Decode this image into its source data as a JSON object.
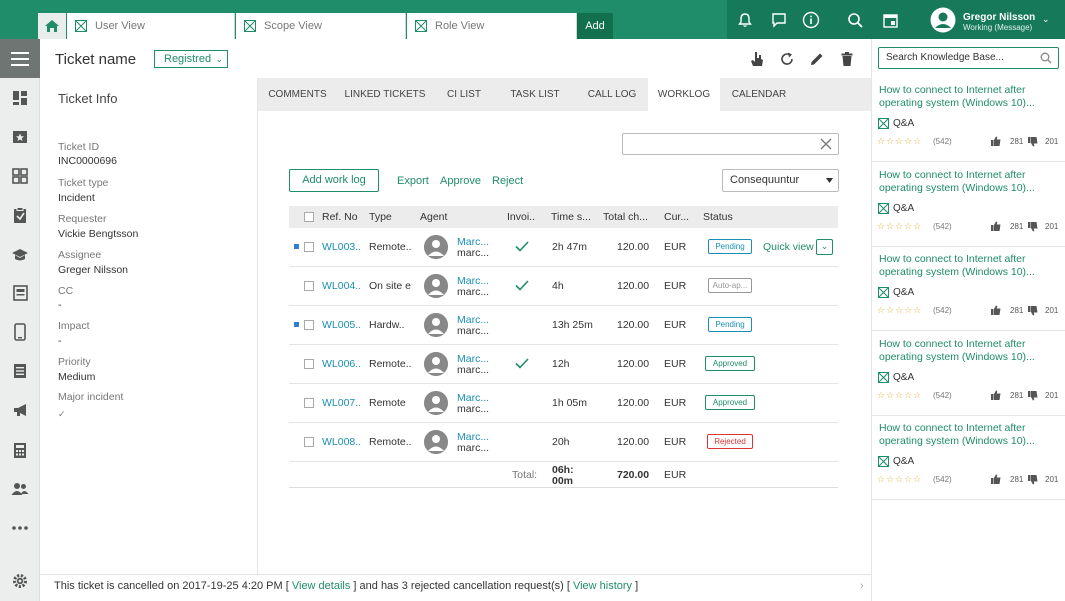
{
  "colors": {
    "brand": "#1f8c6a",
    "brand_dark": "#167a5a",
    "link": "#1a8fb3",
    "rejected": "#d33333",
    "pending_dot": "#2f7fd8"
  },
  "tabs": [
    {
      "label": "User View",
      "icon": "grid-x-icon"
    },
    {
      "label": "Scope View",
      "icon": "grid-x-icon"
    },
    {
      "label": "Role View",
      "icon": "grid-x-icon"
    }
  ],
  "add_tab": "Add",
  "user": {
    "name": "Gregor Nilsson",
    "status": "Working (Message)"
  },
  "header": {
    "ticket_name": "Ticket name",
    "status": "Registred"
  },
  "info": {
    "title": "Ticket Info",
    "fields": [
      {
        "label": "Ticket ID",
        "value": "INC0000696"
      },
      {
        "label": "Ticket type",
        "value": "Incident"
      },
      {
        "label": "Requester",
        "value": "Vickie Bengtsson"
      },
      {
        "label": "Assignee",
        "value": "Greger Nilsson"
      },
      {
        "label": "CC",
        "value": "-"
      },
      {
        "label": "Impact",
        "value": "-"
      },
      {
        "label": "Priority",
        "value": "Medium"
      },
      {
        "label": "Major incident",
        "value": "✓"
      }
    ]
  },
  "panel_tabs": [
    "COMMENTS",
    "LINKED TICKETS",
    "CI LIST",
    "TASK LIST",
    "CALL LOG",
    "WORKLOG",
    "CALENDAR"
  ],
  "worklog": {
    "add_label": "Add work log",
    "export_label": "Export",
    "approve_label": "Approve",
    "reject_label": "Reject",
    "filter_value": "Consequuntur",
    "search_value": "",
    "columns": [
      "Ref. No",
      "Type",
      "Agent",
      "Invoi..",
      "Time s...",
      "Total ch...",
      "Cur...",
      "Status"
    ],
    "rows": [
      {
        "ref": "WL003..",
        "type": "Remote..",
        "agent_name": "Marc...",
        "agent_sub": "marc...",
        "invoiced": true,
        "time": "2h 47m",
        "total": "120.00",
        "currency": "EUR",
        "status": "Pending",
        "status_kind": "pending",
        "unread": true
      },
      {
        "ref": "WL004..",
        "type": "On site e...",
        "agent_name": "Marc...",
        "agent_sub": "marc...",
        "invoiced": true,
        "time": "4h",
        "total": "120.00",
        "currency": "EUR",
        "status": "Auto-ap...",
        "status_kind": "auto",
        "unread": false
      },
      {
        "ref": "WL005..",
        "type": "Hardw..",
        "agent_name": "Marc...",
        "agent_sub": "marc...",
        "invoiced": false,
        "time": "13h 25m",
        "total": "120.00",
        "currency": "EUR",
        "status": "Pending",
        "status_kind": "pending",
        "unread": true
      },
      {
        "ref": "WL006..",
        "type": "Remote..",
        "agent_name": "Marc...",
        "agent_sub": "marc...",
        "invoiced": true,
        "time": "12h",
        "total": "120.00",
        "currency": "EUR",
        "status": "Approved",
        "status_kind": "approved",
        "unread": false
      },
      {
        "ref": "WL007..",
        "type": "Remote",
        "agent_name": "Marc...",
        "agent_sub": "marc...",
        "invoiced": false,
        "time": "1h 05m",
        "total": "120.00",
        "currency": "EUR",
        "status": "Approved",
        "status_kind": "approved",
        "unread": false
      },
      {
        "ref": "WL008..",
        "type": "Remote..",
        "agent_name": "Marc...",
        "agent_sub": "marc...",
        "invoiced": false,
        "time": "20h",
        "total": "120.00",
        "currency": "EUR",
        "status": "Rejected",
        "status_kind": "rejected",
        "unread": false
      }
    ],
    "quick_view": "Quick view",
    "totals": {
      "label": "Total:",
      "time_line1": "06h:",
      "time_line2": "00m",
      "amount": "720.00",
      "currency": "EUR"
    }
  },
  "footer": {
    "text1": "This ticket is cancelled on 2017-19-25 4:20 PM [",
    "link1": "View details",
    "text2": "] and has 3 rejected cancellation request(s)  [",
    "link2": "View history",
    "text3": "]"
  },
  "kb": {
    "search_placeholder": "Search Knowledge Base...",
    "items": [
      {
        "title": "How to connect to Internet after operating system (Windows 10)...",
        "type": "Q&A",
        "stars": "☆☆☆☆☆",
        "count": "(542)",
        "up": "281",
        "down": "201"
      },
      {
        "title": "How to connect to Internet after operating system (Windows 10)...",
        "type": "Q&A",
        "stars": "☆☆☆☆☆",
        "count": "(542)",
        "up": "281",
        "down": "201"
      },
      {
        "title": "How to connect to Internet after operating system (Windows 10)...",
        "type": "Q&A",
        "stars": "☆☆☆☆☆",
        "count": "(542)",
        "up": "281",
        "down": "201"
      },
      {
        "title": "How to connect to Internet after operating system (Windows 10)...",
        "type": "Q&A",
        "stars": "☆☆☆☆☆",
        "count": "(542)",
        "up": "281",
        "down": "201"
      },
      {
        "title": "How to connect to Internet after operating system (Windows 10)...",
        "type": "Q&A",
        "stars": "☆☆☆☆☆",
        "count": "(542)",
        "up": "281",
        "down": "201"
      }
    ]
  }
}
